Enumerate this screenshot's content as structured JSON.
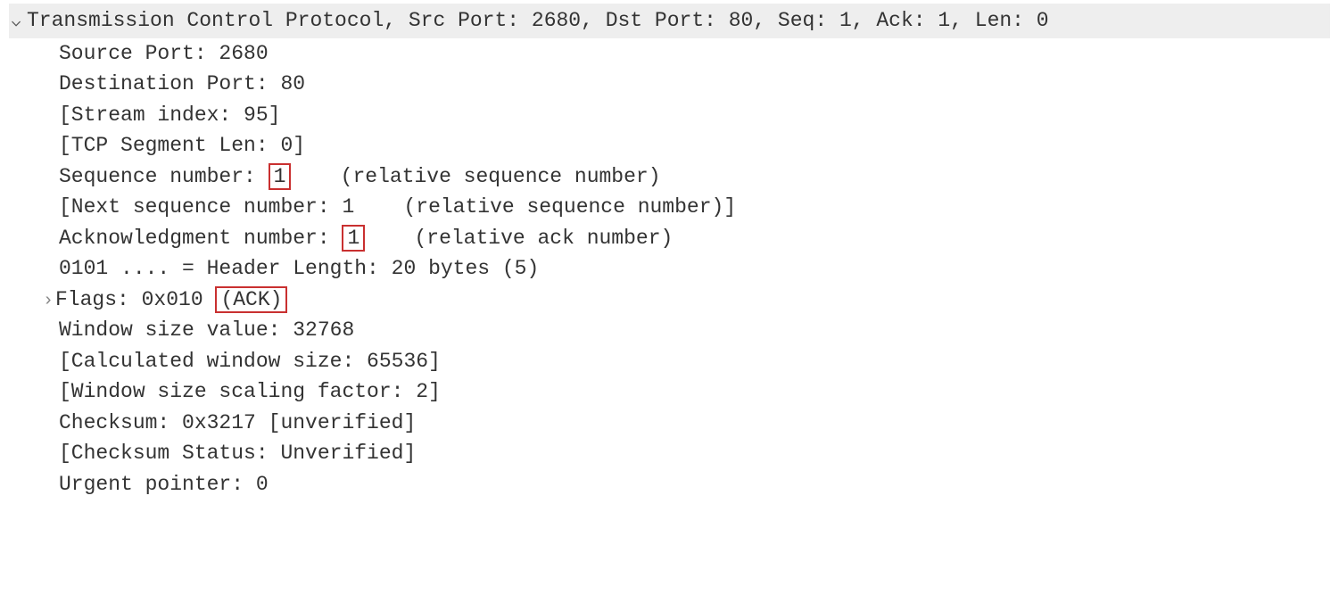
{
  "header": {
    "text": "Transmission Control Protocol, Src Port: 2680, Dst Port: 80, Seq: 1, Ack: 1, Len: 0"
  },
  "lines": {
    "source_port": "Source Port: 2680",
    "dest_port": "Destination Port: 80",
    "stream_index": "[Stream index: 95]",
    "tcp_segment_len": "[TCP Segment Len: 0]",
    "seq_prefix": "Sequence number: ",
    "seq_boxed": "1",
    "seq_suffix": "    (relative sequence number)",
    "next_seq": "[Next sequence number: 1    (relative sequence number)]",
    "ack_prefix": "Acknowledgment number: ",
    "ack_boxed": "1",
    "ack_suffix": "    (relative ack number)",
    "header_len": "0101 .... = Header Length: 20 bytes (5)",
    "flags_prefix": "Flags: 0x010 ",
    "flags_boxed": "(ACK)",
    "window_size": "Window size value: 32768",
    "calc_window": "[Calculated window size: 65536]",
    "scaling_factor": "[Window size scaling factor: 2]",
    "checksum": "Checksum: 0x3217 [unverified]",
    "checksum_status": "[Checksum Status: Unverified]",
    "urgent_ptr": "Urgent pointer: 0"
  }
}
